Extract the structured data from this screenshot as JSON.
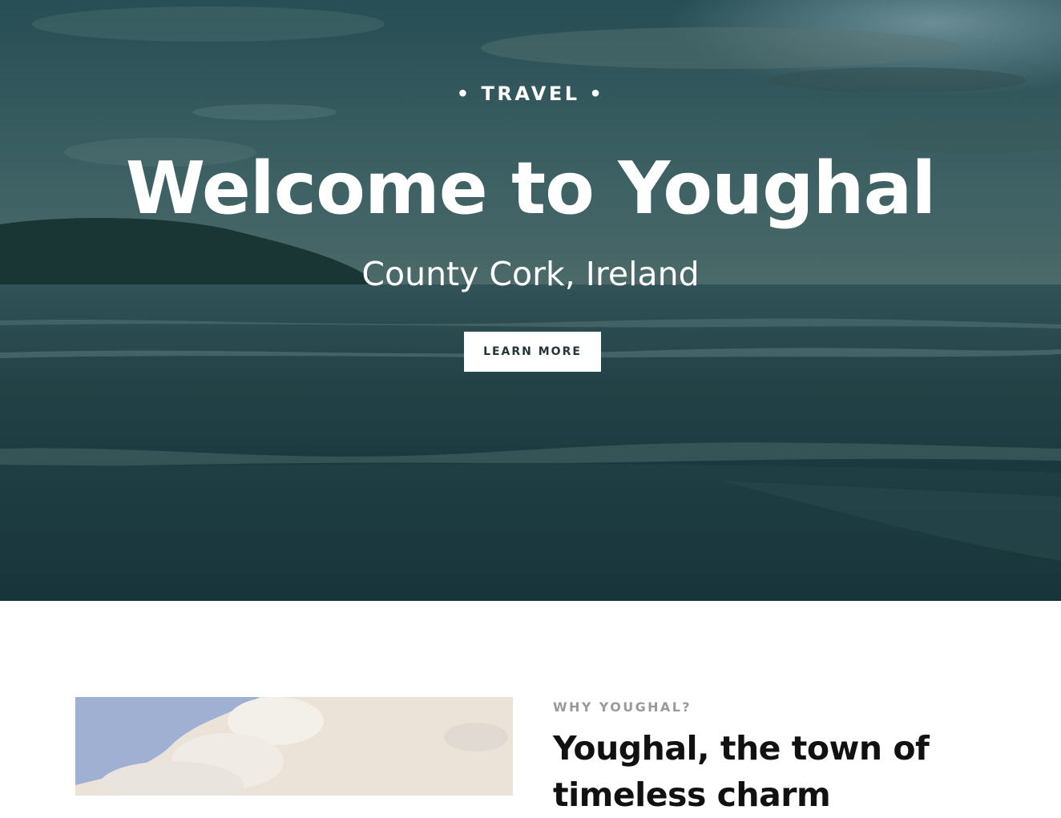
{
  "hero": {
    "eyebrow": "• TRAVEL •",
    "title": "Welcome to Youghal",
    "subtitle": "County Cork, Ireland",
    "button_label": "LEARN MORE"
  },
  "about": {
    "eyebrow": "WHY YOUGHAL?",
    "title": "Youghal, the town of timeless charm"
  },
  "colors": {
    "hero_overlay": "#1f3e43",
    "button_bg": "#ffffff",
    "button_text": "#23343a",
    "eyebrow_gray": "#9a9a9a",
    "heading_dark": "#111111"
  }
}
